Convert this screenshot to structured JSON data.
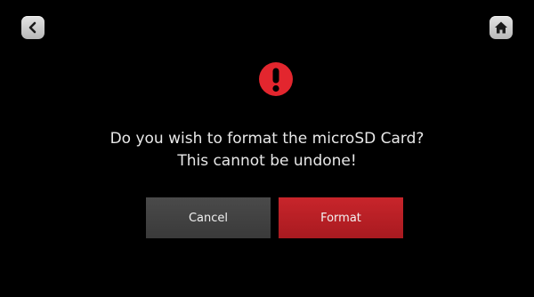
{
  "header": {
    "back_icon": "chevron-left-icon",
    "home_icon": "home-icon"
  },
  "dialog": {
    "icon": "exclamation-circle-icon",
    "icon_color": "#e3262e",
    "message_line1": "Do you wish to format the microSD Card?",
    "message_line2": "This cannot be undone!",
    "cancel_label": "Cancel",
    "confirm_label": "Format"
  },
  "colors": {
    "background": "#000000",
    "cancel_button": "#444444",
    "confirm_button": "#bd2027",
    "text": "#e8e8e8"
  }
}
